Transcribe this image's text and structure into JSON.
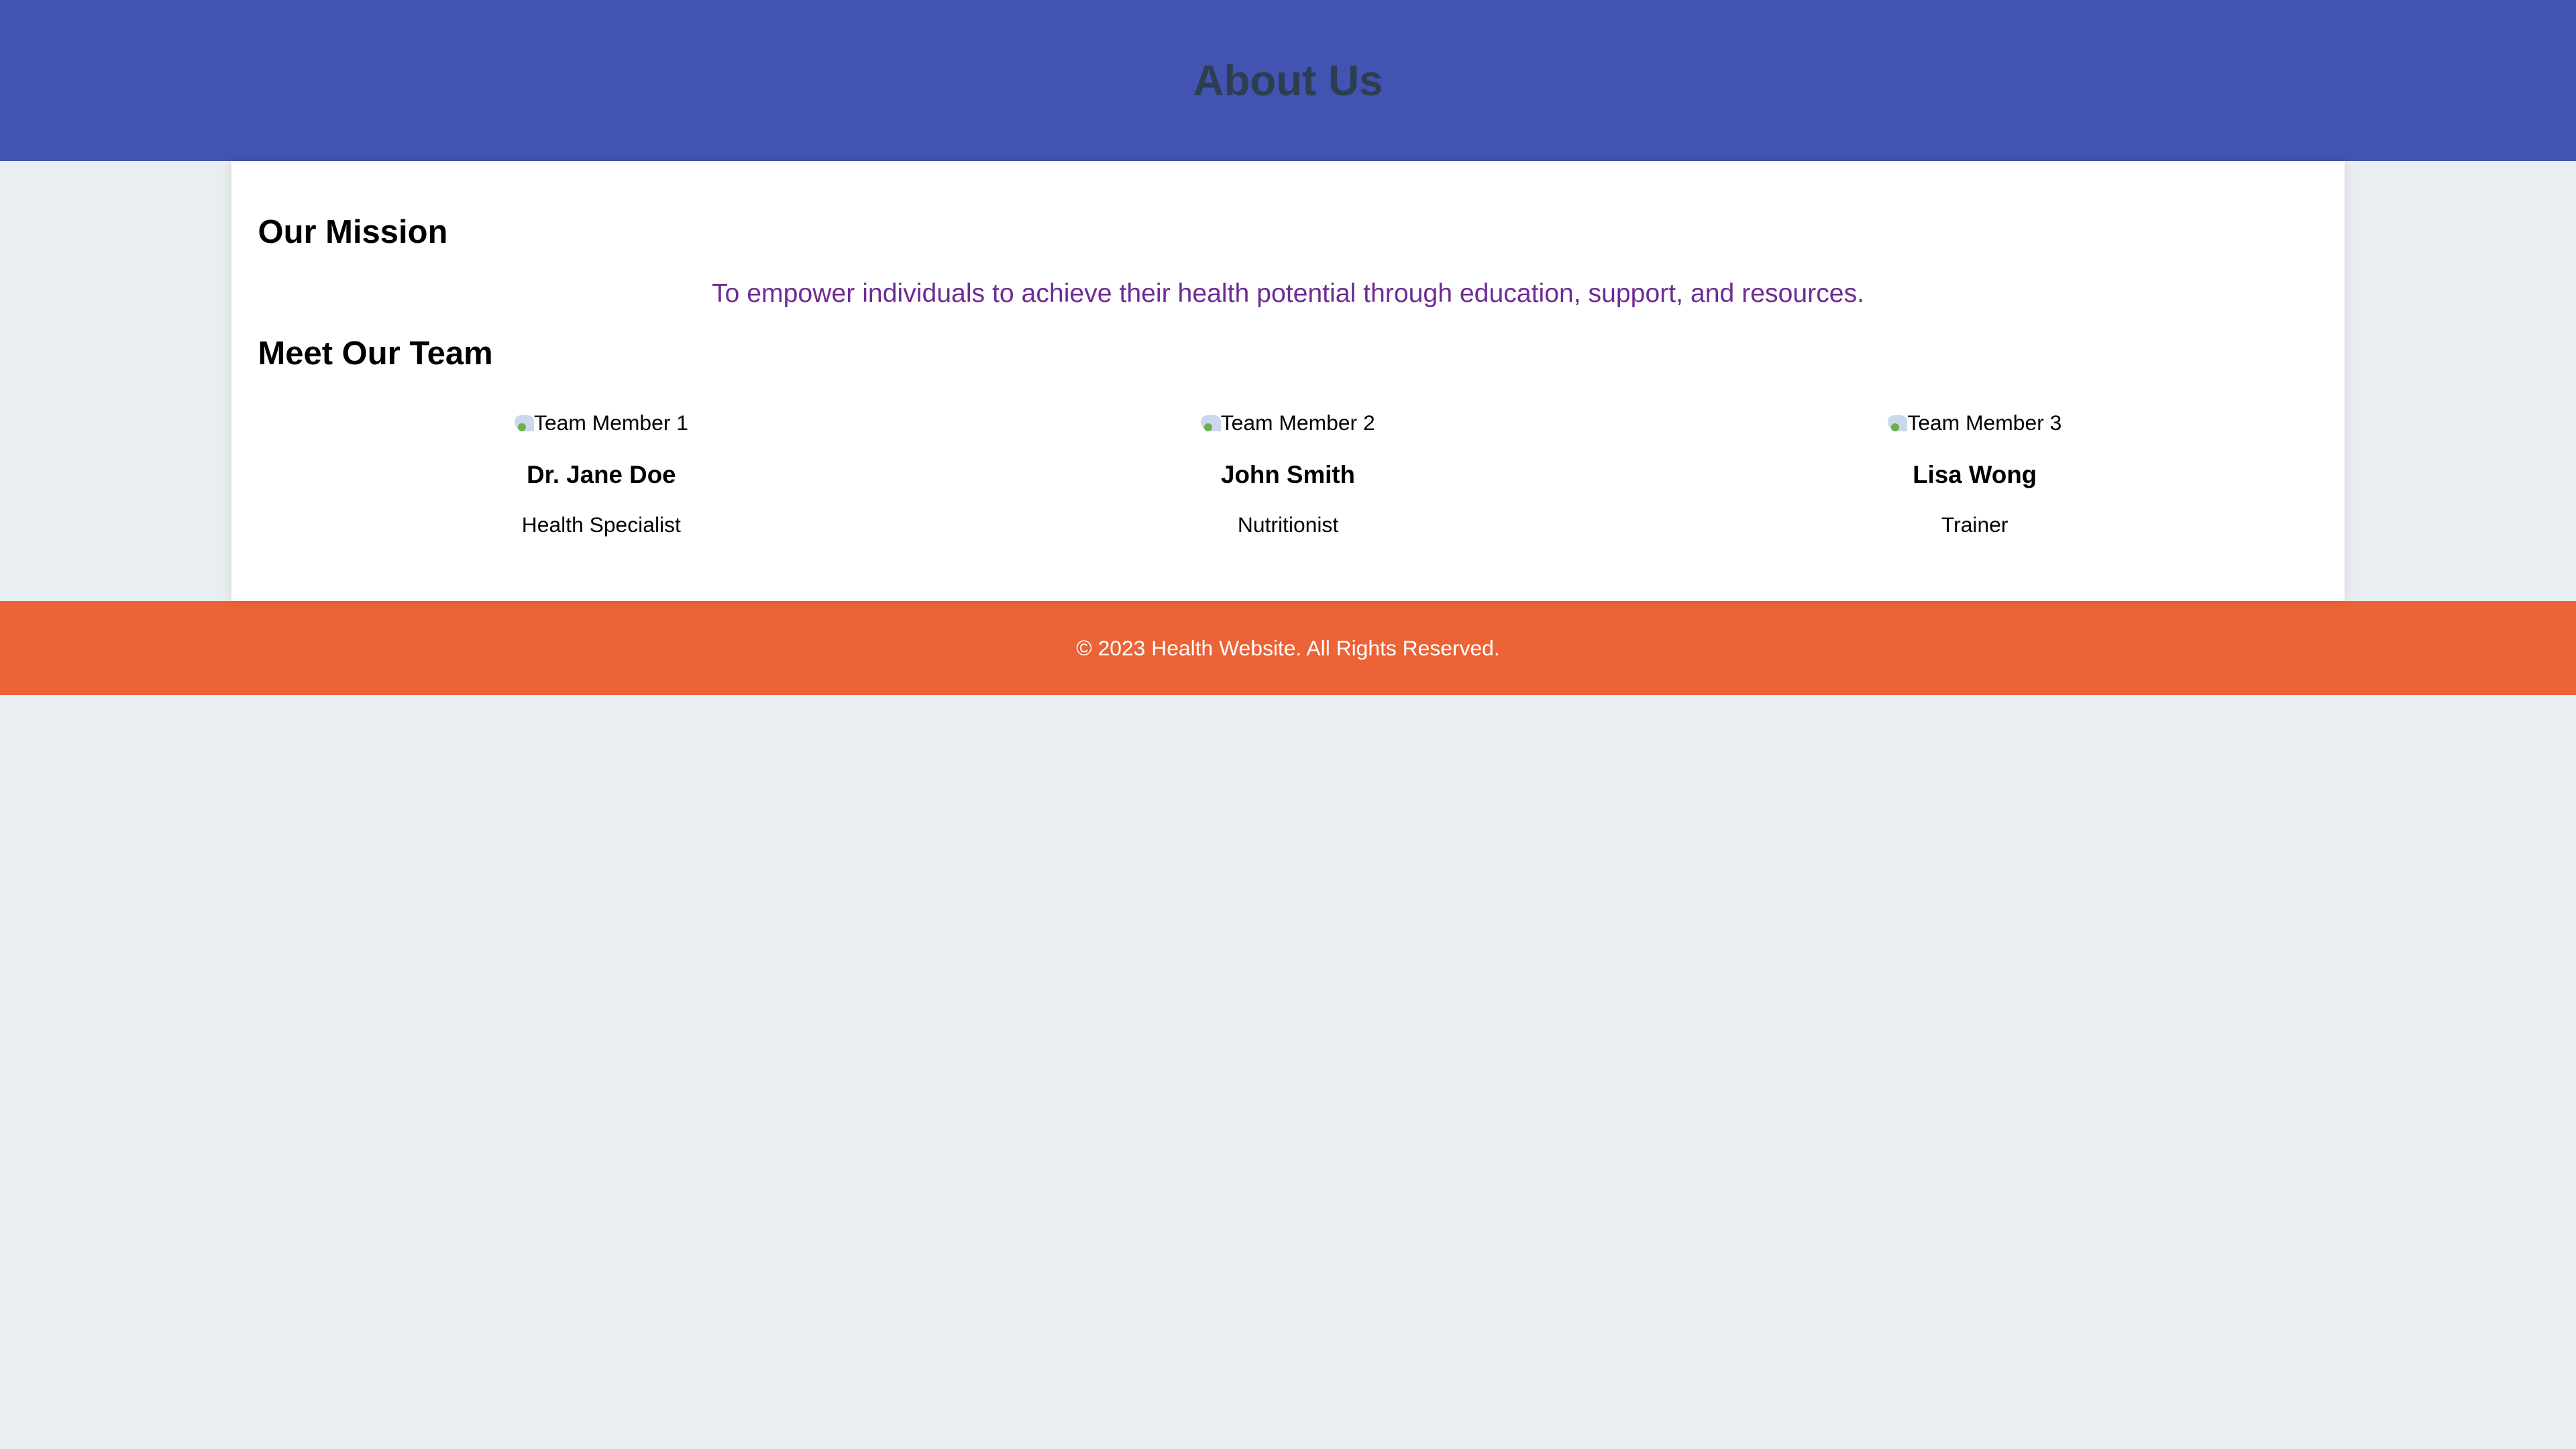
{
  "header": {
    "title": "About Us"
  },
  "mission": {
    "heading": "Our Mission",
    "text": "To empower individuals to achieve their health potential through education, support, and resources."
  },
  "team": {
    "heading": "Meet Our Team",
    "members": [
      {
        "img_alt": "Team Member 1",
        "name": "Dr. Jane Doe",
        "role": "Health Specialist"
      },
      {
        "img_alt": "Team Member 2",
        "name": "John Smith",
        "role": "Nutritionist"
      },
      {
        "img_alt": "Team Member 3",
        "name": "Lisa Wong",
        "role": "Trainer"
      }
    ]
  },
  "footer": {
    "text": "© 2023 Health Website. All Rights Reserved."
  },
  "colors": {
    "header": "#4353b1",
    "footer": "#ec6337",
    "mission_text": "#6e2c94"
  }
}
